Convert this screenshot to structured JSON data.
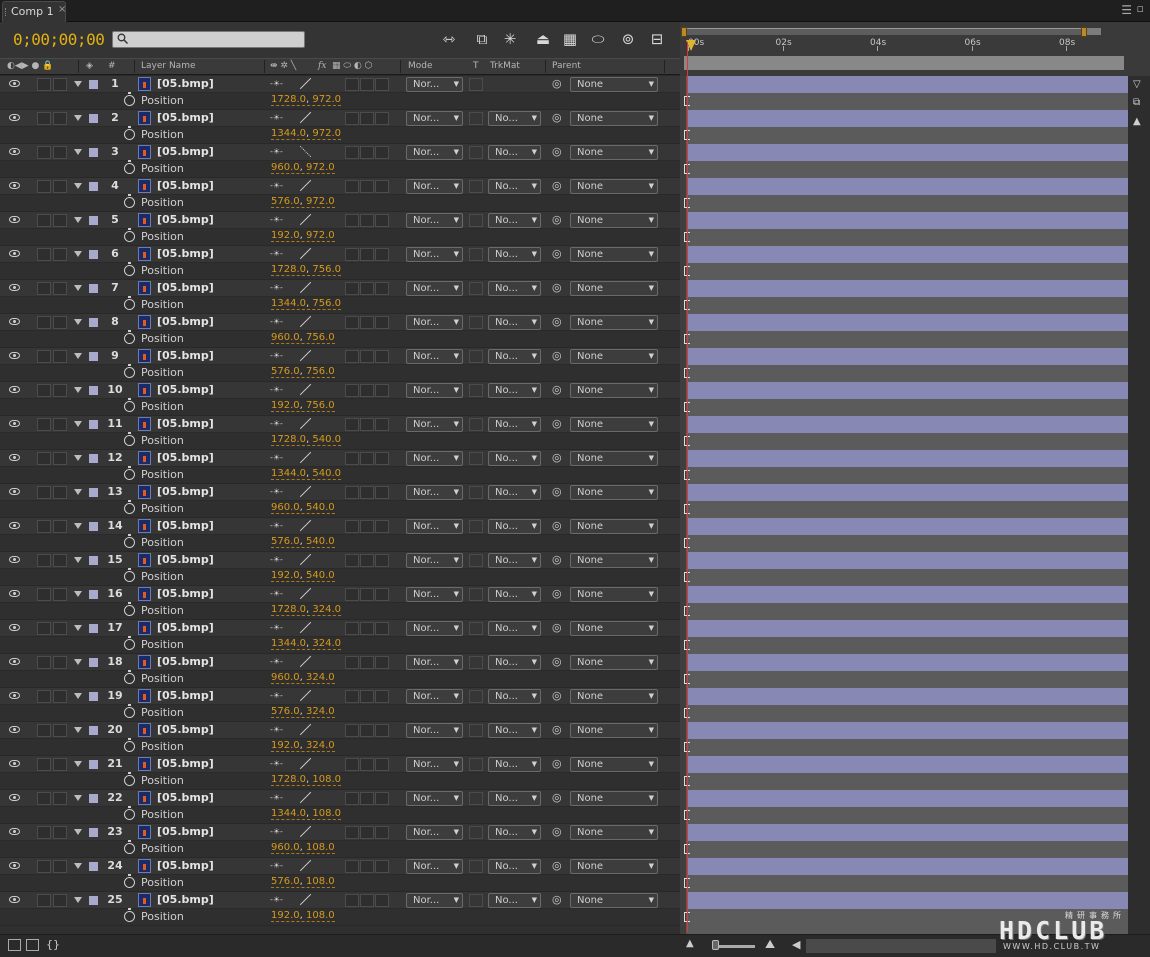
{
  "tab": {
    "title": "Comp 1",
    "close": "×"
  },
  "toolbar": {
    "timecode": "0;00;00;00",
    "search_value": "",
    "buttons": [
      {
        "name": "comp-mini-flowchart-icon",
        "glyph": "⇿"
      },
      {
        "name": "draft-3d-icon",
        "glyph": "⧉"
      },
      {
        "name": "shy-layers-icon",
        "glyph": "✳"
      },
      {
        "name": "frame-blending-icon",
        "glyph": "⏏"
      },
      {
        "name": "motion-blur-icon",
        "glyph": "▦"
      },
      {
        "name": "brainstorm-icon",
        "glyph": "⬭"
      },
      {
        "name": "auto-keyframe-icon",
        "glyph": "⊚"
      },
      {
        "name": "graph-editor-icon",
        "glyph": "⊟"
      }
    ]
  },
  "columns": {
    "num": "#",
    "layer_name": "Layer Name",
    "fx": "fx",
    "mode": "Mode",
    "t": "T",
    "trkmat": "TrkMat",
    "parent": "Parent"
  },
  "layer_template": {
    "name": "[05.bmp]",
    "mode": "Nor...",
    "trkmat": "No...",
    "parent": "None",
    "property": "Position"
  },
  "layers": [
    {
      "num": "1",
      "x": "1728.0",
      "y": "972.0"
    },
    {
      "num": "2",
      "x": "1344.0",
      "y": "972.0"
    },
    {
      "num": "3",
      "x": "960.0",
      "y": "972.0"
    },
    {
      "num": "4",
      "x": "576.0",
      "y": "972.0"
    },
    {
      "num": "5",
      "x": "192.0",
      "y": "972.0"
    },
    {
      "num": "6",
      "x": "1728.0",
      "y": "756.0"
    },
    {
      "num": "7",
      "x": "1344.0",
      "y": "756.0"
    },
    {
      "num": "8",
      "x": "960.0",
      "y": "756.0"
    },
    {
      "num": "9",
      "x": "576.0",
      "y": "756.0"
    },
    {
      "num": "10",
      "x": "192.0",
      "y": "756.0"
    },
    {
      "num": "11",
      "x": "1728.0",
      "y": "540.0"
    },
    {
      "num": "12",
      "x": "1344.0",
      "y": "540.0"
    },
    {
      "num": "13",
      "x": "960.0",
      "y": "540.0"
    },
    {
      "num": "14",
      "x": "576.0",
      "y": "540.0"
    },
    {
      "num": "15",
      "x": "192.0",
      "y": "540.0"
    },
    {
      "num": "16",
      "x": "1728.0",
      "y": "324.0"
    },
    {
      "num": "17",
      "x": "1344.0",
      "y": "324.0"
    },
    {
      "num": "18",
      "x": "960.0",
      "y": "324.0"
    },
    {
      "num": "19",
      "x": "576.0",
      "y": "324.0"
    },
    {
      "num": "20",
      "x": "192.0",
      "y": "324.0"
    },
    {
      "num": "21",
      "x": "1728.0",
      "y": "108.0"
    },
    {
      "num": "22",
      "x": "1344.0",
      "y": "108.0"
    },
    {
      "num": "23",
      "x": "960.0",
      "y": "108.0"
    },
    {
      "num": "24",
      "x": "576.0",
      "y": "108.0"
    },
    {
      "num": "25",
      "x": "192.0",
      "y": "108.0"
    }
  ],
  "timeline": {
    "ticks": [
      "00s",
      "02s",
      "04s",
      "06s",
      "08s"
    ],
    "bar_color": "#8888b4",
    "cti_color": "#d83a3a"
  },
  "logo": {
    "main": "HDCLUB",
    "sub": "WWW.HD.CLUB.TW",
    "cn": "精研事務所"
  }
}
